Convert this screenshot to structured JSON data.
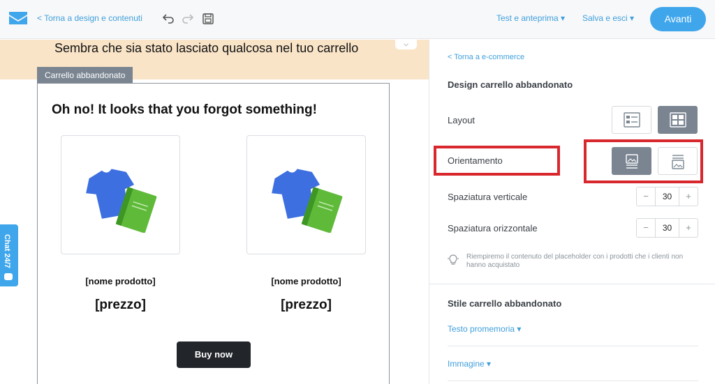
{
  "topbar": {
    "logo_icon": "envelope-logo-icon",
    "back_label": "< Torna a design e contenuti",
    "undo_icon": "undo-icon",
    "redo_icon": "redo-icon",
    "save_icon": "floppy-save-icon",
    "test_menu_label": "Test e anteprima ▾",
    "save_exit_label": "Salva e esci ▾",
    "next_label": "Avanti"
  },
  "canvas": {
    "banner_text": "Sembra che sia stato lasciato qualcosa nel tuo carrello",
    "block_tag": "Carrello abbandonato",
    "email_title": "Oh no! It looks that you forgot something!",
    "products": [
      {
        "name": "[nome prodotto]",
        "price": "[prezzo]",
        "image_icon": "tshirt-book-icon"
      },
      {
        "name": "[nome prodotto]",
        "price": "[prezzo]",
        "image_icon": "tshirt-book-icon"
      }
    ],
    "cta_label": "Buy now"
  },
  "chat": {
    "label": "Chat 24/7",
    "icon": "chat-bubble-icon"
  },
  "panel": {
    "back_label": "< Torna a e-commerce",
    "design_heading": "Design carrello abbandonato",
    "layout_label": "Layout",
    "orientation_label": "Orientamento",
    "vertical_spacing_label": "Spaziatura verticale",
    "vertical_spacing_value": "30",
    "horizontal_spacing_label": "Spaziatura orizzontale",
    "horizontal_spacing_value": "30",
    "minus": "−",
    "plus": "+",
    "hint_text": "Riempiremo il contenuto del placeholder con i prodotti che i clienti non hanno acquistato",
    "hint_icon": "lightbulb-icon",
    "style_heading": "Stile carrello abbandonato",
    "reminder_text_label": "Testo promemoria ▾",
    "image_label": "Immagine ▾"
  },
  "colors": {
    "accent": "#3fa6ec",
    "highlight": "#d9272e",
    "banner": "#f9e4c8",
    "active_option": "#7a8591"
  }
}
